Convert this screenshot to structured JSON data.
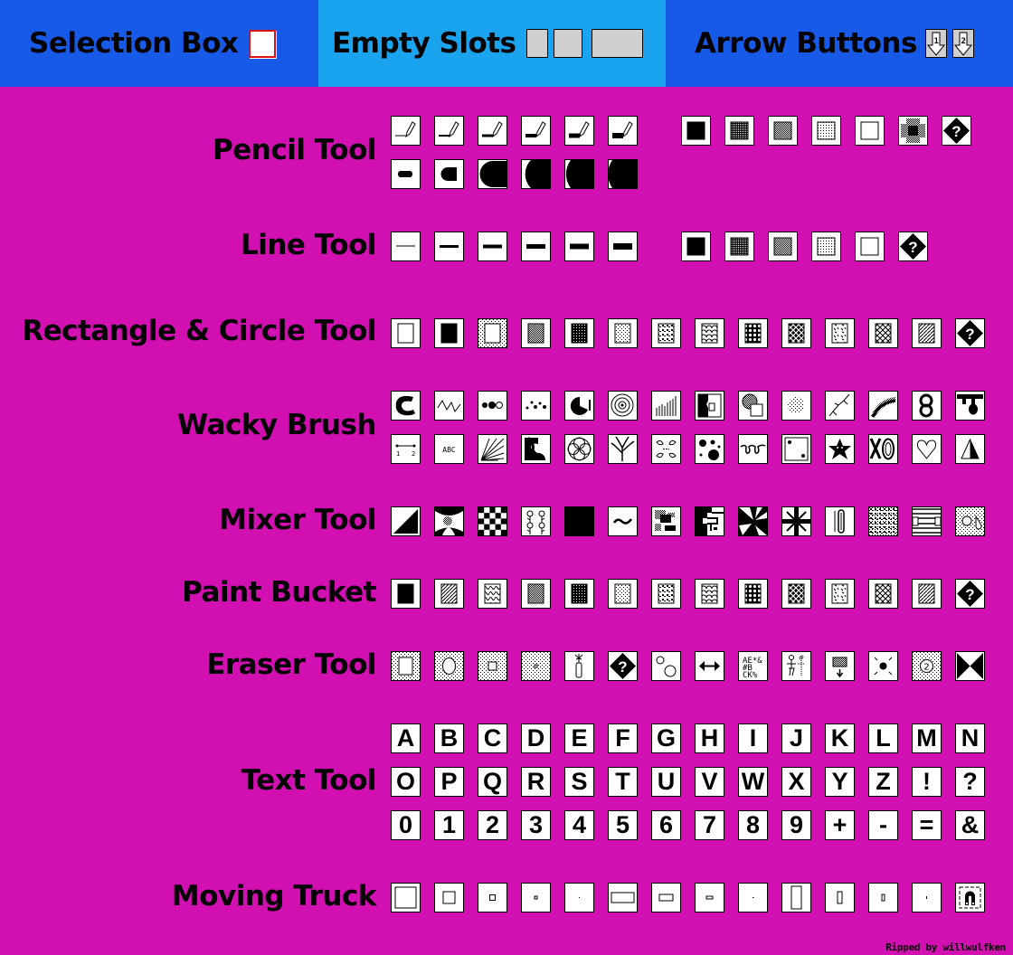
{
  "header": {
    "selection_box_label": "Selection Box",
    "empty_slots_label": "Empty Slots",
    "arrow_buttons_label": "Arrow Buttons",
    "arrow_button_1": "1",
    "arrow_button_2": "2"
  },
  "colors": {
    "background": "#d20fb0",
    "header_dark_blue": "#185ae8",
    "header_light_blue": "#1aa3ee",
    "selection_border": "#e01010",
    "slot_gray": "#cfcfcf"
  },
  "sections": {
    "pencil": {
      "label": "Pencil Tool",
      "row1": [
        "pencil-size-1",
        "pencil-size-2",
        "pencil-size-3",
        "pencil-size-4",
        "pencil-size-5",
        "pencil-size-6",
        "gap",
        "fill-black",
        "fill-dense-dots",
        "fill-checker",
        "fill-light-dots",
        "fill-white",
        "fill-spray",
        "random-question"
      ],
      "row2": [
        "brush-size-1",
        "brush-size-2",
        "brush-size-3",
        "brush-size-4",
        "brush-size-5",
        "brush-size-6"
      ]
    },
    "line": {
      "label": "Line Tool",
      "row1": [
        "line-width-1",
        "line-width-2",
        "line-width-3",
        "line-width-4",
        "line-width-5",
        "line-width-6",
        "gap",
        "fill-black",
        "fill-dense-dots",
        "fill-checker",
        "fill-light-dots",
        "fill-white",
        "random-question"
      ]
    },
    "rect": {
      "label": "Rectangle & Circle Tool",
      "row1": [
        "rect-hollow",
        "rect-filled",
        "rect-dotted-border",
        "rect-checker",
        "rect-dots-black",
        "rect-sparse-dots",
        "rect-blobs",
        "rect-scales",
        "rect-circles-dark",
        "rect-crosshatch",
        "rect-cracks",
        "rect-diamond",
        "rect-diagonal",
        "random-question"
      ]
    },
    "wacky": {
      "label": "Wacky Brush",
      "row1": [
        "wacky-c-blob",
        "wacky-zigzag",
        "wacky-bubbles",
        "wacky-dot-trail",
        "wacky-pacman",
        "wacky-rings",
        "wacky-bars",
        "wacky-mirror",
        "wacky-checker-circle",
        "wacky-spray-dots",
        "wacky-lightning",
        "wacky-rainbow-arc",
        "wacky-knot",
        "wacky-drip"
      ],
      "row2": [
        "wacky-measure-1-2",
        "wacky-abc",
        "wacky-rays",
        "wacky-snake",
        "wacky-mandala",
        "wacky-tree",
        "wacky-kaleido",
        "wacky-spots",
        "wacky-loops",
        "wacky-dice",
        "wacky-star",
        "wacky-xo",
        "wacky-heart",
        "wacky-triangle"
      ]
    },
    "mixer": {
      "label": "Mixer Tool",
      "row1": [
        "mixer-diagonal",
        "mixer-fan",
        "mixer-checkerboard",
        "mixer-flowers",
        "mixer-stripes",
        "mixer-squiggle",
        "mixer-pixelate",
        "mixer-blocks",
        "mixer-shatter",
        "mixer-implode",
        "mixer-slot",
        "mixer-noise",
        "mixer-blinds",
        "mixer-dissolve"
      ]
    },
    "bucket": {
      "label": "Paint Bucket",
      "row1": [
        "bucket-black",
        "bucket-bricks",
        "bucket-waves",
        "bucket-checker",
        "bucket-dots-black",
        "bucket-sparse-dots",
        "bucket-blobs",
        "bucket-scales",
        "bucket-circles-dark",
        "bucket-crosshatch",
        "bucket-cracks",
        "bucket-diamond",
        "bucket-diagonal",
        "random-question"
      ]
    },
    "eraser": {
      "label": "Eraser Tool",
      "row1": [
        "eraser-large",
        "eraser-circle",
        "eraser-medium",
        "eraser-small",
        "eraser-firecracker",
        "random-question",
        "eraser-bubbles",
        "eraser-arrows",
        "eraser-letters",
        "eraser-people",
        "eraser-drop",
        "eraser-implode",
        "eraser-number-2",
        "eraser-bowtie"
      ]
    },
    "text": {
      "label": "Text Tool",
      "row1": [
        "A",
        "B",
        "C",
        "D",
        "E",
        "F",
        "G",
        "H",
        "I",
        "J",
        "K",
        "L",
        "M",
        "N"
      ],
      "row2": [
        "O",
        "P",
        "Q",
        "R",
        "S",
        "T",
        "U",
        "V",
        "W",
        "X",
        "Y",
        "Z",
        "!",
        "?"
      ],
      "row3": [
        "0",
        "1",
        "2",
        "3",
        "4",
        "5",
        "6",
        "7",
        "8",
        "9",
        "+",
        "-",
        "=",
        "&"
      ]
    },
    "truck": {
      "label": "Moving Truck",
      "row1": [
        "select-rect-xl",
        "select-rect-l",
        "select-rect-m",
        "select-rect-s",
        "select-rect-xs",
        "select-wide-xl",
        "select-wide-l",
        "select-wide-m",
        "select-wide-s",
        "select-tall-xl",
        "select-tall-l",
        "select-tall-m",
        "select-tall-s",
        "select-magnet"
      ]
    }
  },
  "credit": "Ripped by willwulfken"
}
